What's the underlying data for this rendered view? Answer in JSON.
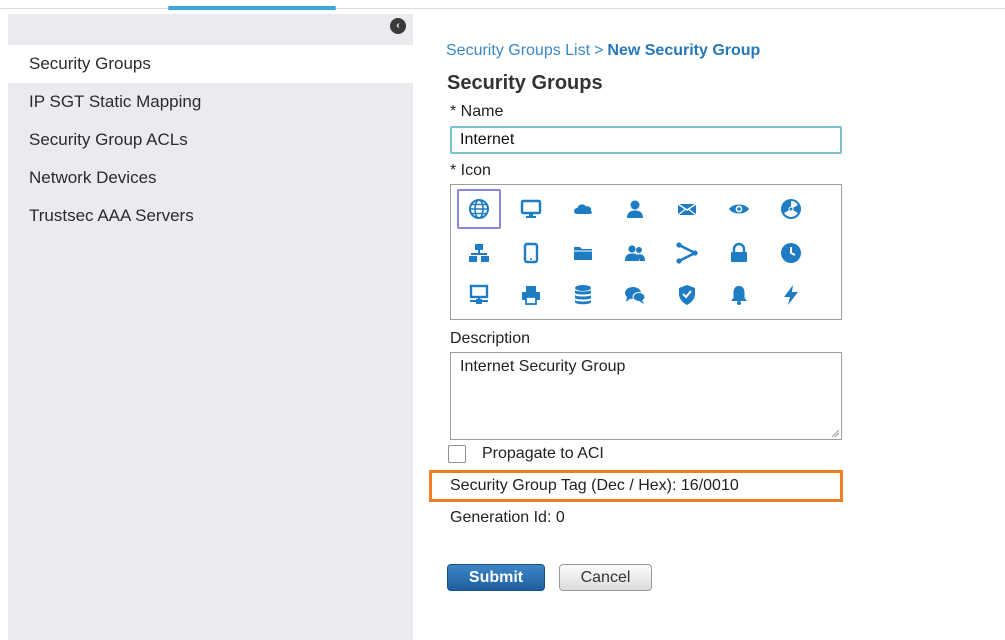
{
  "sidebar": {
    "items": [
      {
        "label": "Security Groups",
        "active": true
      },
      {
        "label": "IP SGT Static Mapping"
      },
      {
        "label": "Security Group ACLs"
      },
      {
        "label": "Network Devices"
      },
      {
        "label": "Trustsec AAA Servers"
      }
    ]
  },
  "breadcrumb": {
    "parent": "Security Groups List",
    "separator": ">",
    "current": "New Security Group"
  },
  "form": {
    "title": "Security Groups",
    "name_label": "* Name",
    "name_value": "Internet",
    "icon_label": "* Icon",
    "icons": [
      [
        "globe-icon",
        "monitor-icon",
        "cloud-icon",
        "user-icon",
        "envelope-icon",
        "eye-icon",
        "radiation-icon"
      ],
      [
        "network-hierarchy-icon",
        "tablet-icon",
        "folder-icon",
        "user-group-icon",
        "share-icon",
        "lock-icon",
        "clock-icon"
      ],
      [
        "server-terminal-icon",
        "printer-icon",
        "database-icon",
        "chat-icon",
        "shield-icon",
        "bell-icon",
        "lightning-icon"
      ]
    ],
    "selected_icon": "globe-icon",
    "description_label": "Description",
    "description_value": "Internet Security Group",
    "propagate_label": "Propagate to ACI",
    "sgt_text": "Security Group Tag (Dec / Hex): 16/0010",
    "generation_text": "Generation Id: 0",
    "submit_label": "Submit",
    "cancel_label": "Cancel"
  },
  "colors": {
    "link": "#3b88c3",
    "icon": "#1d7cc4",
    "highlight": "#f07d22",
    "sidebar_bg": "#e9ebef"
  }
}
